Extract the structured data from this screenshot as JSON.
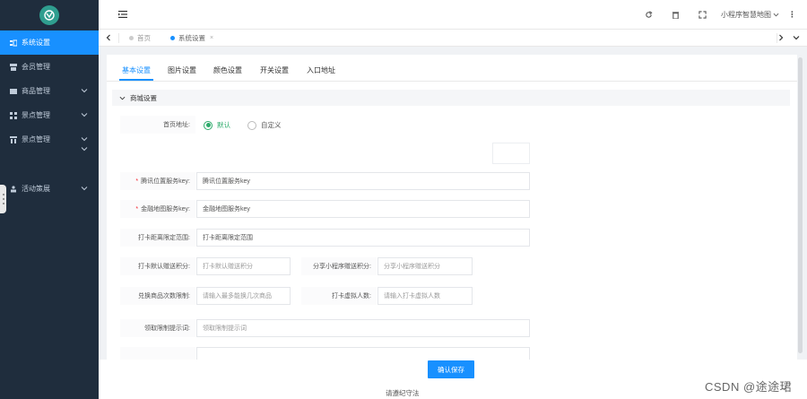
{
  "sidebar": {
    "items": [
      {
        "label": "系统设置",
        "icon": "settings-icon",
        "active": true
      },
      {
        "label": "会员管理",
        "icon": "member-icon",
        "active": false
      },
      {
        "label": "商品管理",
        "icon": "goods-icon",
        "active": false,
        "expandable": true
      },
      {
        "label": "景点管理",
        "icon": "grid-icon",
        "active": false,
        "expandable": true
      },
      {
        "label": "景点管理",
        "icon": "building-icon",
        "active": false,
        "expandable": true
      },
      {
        "label": "活动策展",
        "icon": "team-icon",
        "active": false,
        "expandable": true
      }
    ]
  },
  "header": {
    "user_name": "小程序智慧地图",
    "icons": [
      "refresh-icon",
      "trash-icon",
      "fullscreen-icon"
    ]
  },
  "tabs": [
    {
      "label": "首页",
      "active": false
    },
    {
      "label": "系统设置",
      "active": true
    }
  ],
  "subtabs": [
    "基本设置",
    "图片设置",
    "颜色设置",
    "开关设置",
    "入口地址"
  ],
  "section": {
    "title": "商城设置"
  },
  "form": {
    "home_addr_label": "首页地址:",
    "radio_default": "默认",
    "radio_custom": "自定义",
    "map_key_label": "腾讯位置服务key:",
    "map_key_value": "腾讯位置服务key",
    "gaode_key_label": "金融地图服务key:",
    "gaode_key_value": "金融地图服务key",
    "checkin_range_label": "打卡距离限定范围:",
    "checkin_range_value": "打卡距离限定范围",
    "checkin_points_label": "打卡默认赠送积分:",
    "checkin_points_value": "打卡默认赠送积分",
    "share_points_label": "分享小程序赠送积分:",
    "share_points_value": "分享小程序赠送积分",
    "goods_limit_label": "兑换商品次数限制:",
    "goods_limit_value": "请输入最多能换几次商品",
    "virtual_count_label": "打卡虚拟人数:",
    "virtual_count_value": "请输入打卡虚拟人数",
    "redeem_tip_label": "领取限制提示词:",
    "redeem_tip_value": "领取限制提示词"
  },
  "footer": {
    "save_label": "确认保存",
    "text": "请遵纪守法"
  },
  "watermark": "CSDN @途途珺",
  "colors": {
    "sidebar_bg": "#1f2d3d",
    "accent": "#1890ff",
    "radio_on": "#2dab6b"
  }
}
